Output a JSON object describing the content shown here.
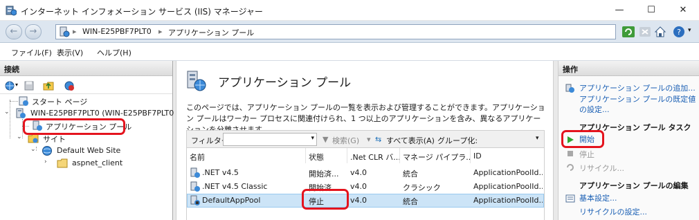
{
  "window": {
    "title": "インターネット インフォメーション サービス (IIS) マネージャー",
    "minimize": "—",
    "maximize": "☐",
    "close": "✕"
  },
  "address": {
    "back": "←",
    "forward": "→",
    "segments": [
      "WIN-E25PBF7PLT0",
      "アプリケーション プール"
    ],
    "separator": "▸"
  },
  "menu": {
    "file": "ファイル(F)",
    "view": "表示(V)",
    "help": "ヘルプ(H)"
  },
  "connections": {
    "header": "接続",
    "tree": {
      "start_page": "スタート ページ",
      "server": "WIN-E25PBF7PLT0 (WIN-E25PBF7PLT0",
      "app_pools": "アプリケーション プール",
      "sites": "サイト",
      "default_site": "Default Web Site",
      "aspnet_client": "aspnet_client"
    }
  },
  "center": {
    "title": "アプリケーション プール",
    "description": "このページでは、アプリケーション プールの一覧を表示および管理することができます。アプリケーション プールはワーカー プロセスに関連付けられ、1 つ以上のアプリケーションを含み、異なるアプリケーションを分離させます。",
    "filter_label": "フィルター:",
    "search": "検索(G)",
    "show_all": "すべて表示(A)",
    "group_by": "グループ化:",
    "columns": [
      "名前",
      "状態",
      ".Net CLR バ...",
      "マネージ パイプラ...",
      "ID"
    ],
    "rows": [
      {
        "name": ".NET v4.5",
        "state": "開始済...",
        "clr": "v4.0",
        "pipeline": "統合",
        "identity": "ApplicationPoolId..."
      },
      {
        "name": ".NET v4.5 Classic",
        "state": "開始済...",
        "clr": "v4.0",
        "pipeline": "クラシック",
        "identity": "ApplicationPoolId..."
      },
      {
        "name": "DefaultAppPool",
        "state": "停止",
        "clr": "v4.0",
        "pipeline": "統合",
        "identity": "ApplicationPoolId..."
      }
    ]
  },
  "actions": {
    "header": "操作",
    "add_pool": "アプリケーション プールの追加...",
    "set_defaults": "アプリケーション プールの既定値の設定...",
    "task_header": "アプリケーション プール タスク",
    "start": "開始",
    "stop": "停止",
    "recycle": "リサイクル...",
    "edit_header": "アプリケーション プールの編集",
    "basic_settings": "基本設定...",
    "recycle_settings": "リサイクルの設定..."
  },
  "colors": {
    "highlight": "#e4141e",
    "link": "#1a5fb4",
    "selection": "#cce4f7"
  }
}
